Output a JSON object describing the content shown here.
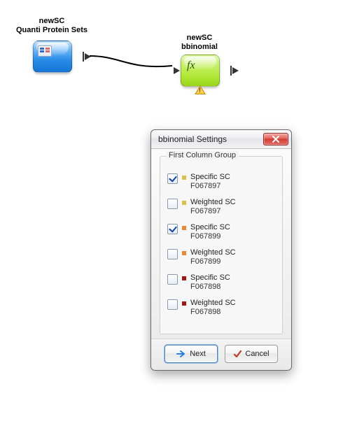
{
  "nodes": {
    "source": {
      "line1": "newSC",
      "line2": "Quanti Protein Sets"
    },
    "func": {
      "line1": "newSC",
      "line2": "bbinomial",
      "fx": "fx"
    }
  },
  "dialog": {
    "title": "bbinomial Settings",
    "group_title": "First Column Group",
    "options": [
      {
        "checked": true,
        "color": "#d6c24a",
        "label": "Specific SC",
        "sub": "F067897"
      },
      {
        "checked": false,
        "color": "#d6c24a",
        "label": "Weighted SC",
        "sub": "F067897"
      },
      {
        "checked": true,
        "color": "#e58a3a",
        "label": "Specific SC",
        "sub": "F067899"
      },
      {
        "checked": false,
        "color": "#e58a3a",
        "label": "Weighted SC",
        "sub": "F067899"
      },
      {
        "checked": false,
        "color": "#a01818",
        "label": "Specific SC",
        "sub": "F067898"
      },
      {
        "checked": false,
        "color": "#a01818",
        "label": "Weighted SC",
        "sub": "F067898"
      }
    ],
    "buttons": {
      "next": "Next",
      "cancel": "Cancel"
    }
  }
}
